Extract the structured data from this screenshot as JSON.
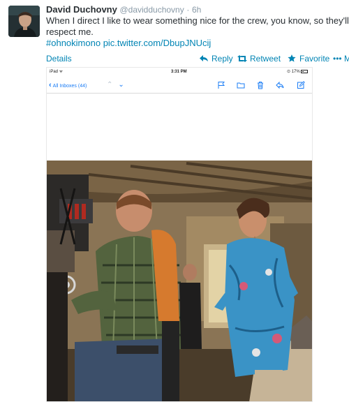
{
  "tweet": {
    "fullname": "David Duchovny",
    "handle": "@davidduchovny",
    "separator": "·",
    "time": "6h",
    "text_line1": "When I direct I like to wear something nice for the crew, you know, so they'll",
    "text_line2": "respect me.",
    "hashtag": "#ohnokimono",
    "pic_link": "pic.twitter.com/DbupJNUcij"
  },
  "actions": {
    "details": "Details",
    "reply": "Reply",
    "retweet": "Retweet",
    "favorite": "Favorite",
    "more_icon": "•••",
    "more_cut": "M"
  },
  "media": {
    "statusbar": {
      "carrier": "iPad ᯤ",
      "time": "3:31 PM",
      "battery": "⊙ 17%"
    },
    "mailbar": {
      "back_label": "All Inboxes (44)",
      "icons": [
        "flag-icon",
        "folder-icon",
        "trash-icon",
        "reply-icon",
        "compose-icon"
      ]
    }
  },
  "colors": {
    "link": "#0084b4",
    "ios_blue": "#1a7cf5",
    "muted": "#8899a6",
    "text": "#292f33"
  }
}
